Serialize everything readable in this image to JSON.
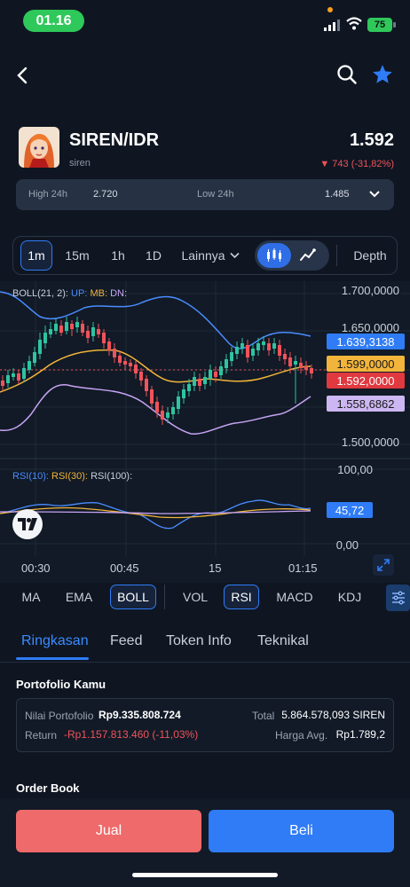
{
  "status_bar": {
    "time": "01.16",
    "battery": "75"
  },
  "coin": {
    "pair": "SIREN/IDR",
    "name": "siren",
    "price": "1.592",
    "change": "743 (-31,82%)",
    "high_label": "High 24h",
    "high_value": "2.720",
    "low_label": "Low 24h",
    "low_value": "1.485"
  },
  "timeframes": {
    "items": [
      "1m",
      "15m",
      "1h",
      "1D"
    ],
    "active": "1m",
    "more": "Lainnya",
    "depth": "Depth"
  },
  "chart_data": [
    {
      "type": "line",
      "legend": [
        "BOLL(21, 2):",
        "UP:",
        "MB:",
        "DN:"
      ],
      "y_ticks": [
        "1.700,0000",
        "1.650,0000",
        "1.500,0000"
      ],
      "price_tags": {
        "up": "1.639,3138",
        "mb": "1.599,0000",
        "last": "1.592,0000",
        "dn": "1.558,6862"
      },
      "x_ticks": [
        "00:30",
        "00:45",
        "15",
        "01:15"
      ],
      "colors": {
        "up": "#4a8cff",
        "mb": "#f2b43a",
        "dn": "#c8a4f5",
        "bull": "#2fc3a0",
        "bear": "#f0535a"
      }
    },
    {
      "type": "line",
      "legend": [
        "RSI(10):",
        "RSI(30):",
        "RSI(100):"
      ],
      "y_ticks": [
        "100,00",
        "0,00"
      ],
      "value_tag": "45,72",
      "colors": {
        "rsi10": "#4a8cff",
        "rsi30": "#f2b43a",
        "rsi100": "#c8a4f5"
      }
    }
  ],
  "indicators": {
    "items": [
      "MA",
      "EMA",
      "BOLL",
      "VOL",
      "RSI",
      "MACD",
      "KDJ"
    ],
    "active": [
      "BOLL",
      "RSI"
    ]
  },
  "sections": {
    "tabs": [
      "Ringkasan",
      "Feed",
      "Token Info",
      "Teknikal"
    ],
    "active": "Ringkasan"
  },
  "portfolio": {
    "title": "Portofolio Kamu",
    "value_label": "Nilai Portofolio",
    "value": "Rp9.335.808.724",
    "total_label": "Total",
    "total": "5.864.578,093 SIREN",
    "return_label": "Return",
    "return_value": "-Rp1.157.813.460 (-11,03%)",
    "avg_label": "Harga Avg.",
    "avg_value": "Rp1.789,2"
  },
  "order_book": {
    "title": "Order Book"
  },
  "actions": {
    "sell": "Jual",
    "buy": "Beli"
  }
}
